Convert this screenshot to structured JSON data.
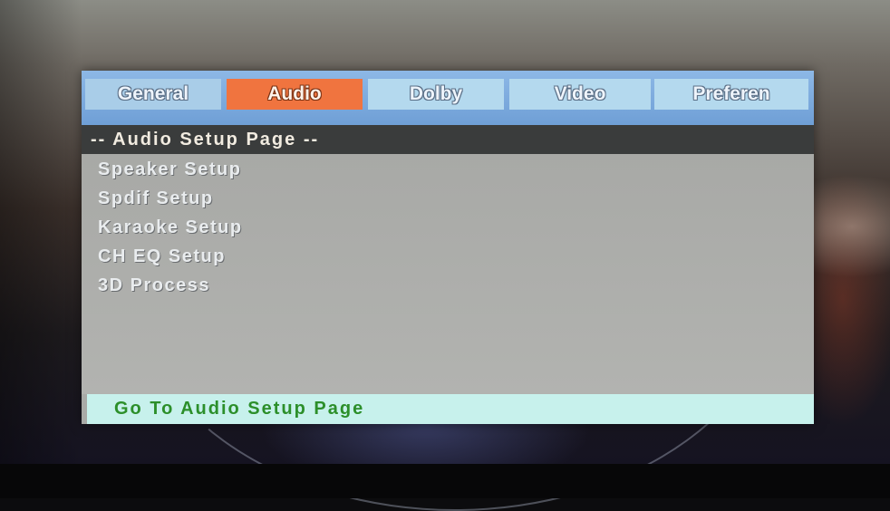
{
  "tabs": [
    "General",
    "Audio",
    "Dolby",
    "Video",
    "Preferen"
  ],
  "selected_tab": "Audio",
  "page_title": "-- Audio Setup Page --",
  "menu_items": [
    "Speaker Setup",
    "Spdif Setup",
    "Karaoke Setup",
    "CH EQ Setup",
    "3D Process"
  ],
  "status": "Go To Audio Setup Page",
  "colors": {
    "tab_bar": "#7fb0e2",
    "tab_selected": "#f0743f",
    "tab_normal": "#b4d9ee",
    "header_bg": "#3a3c3c",
    "menu_bg": "#a9aaa7",
    "status_bg": "#c7f1ec",
    "status_text": "#2c8f2a"
  }
}
